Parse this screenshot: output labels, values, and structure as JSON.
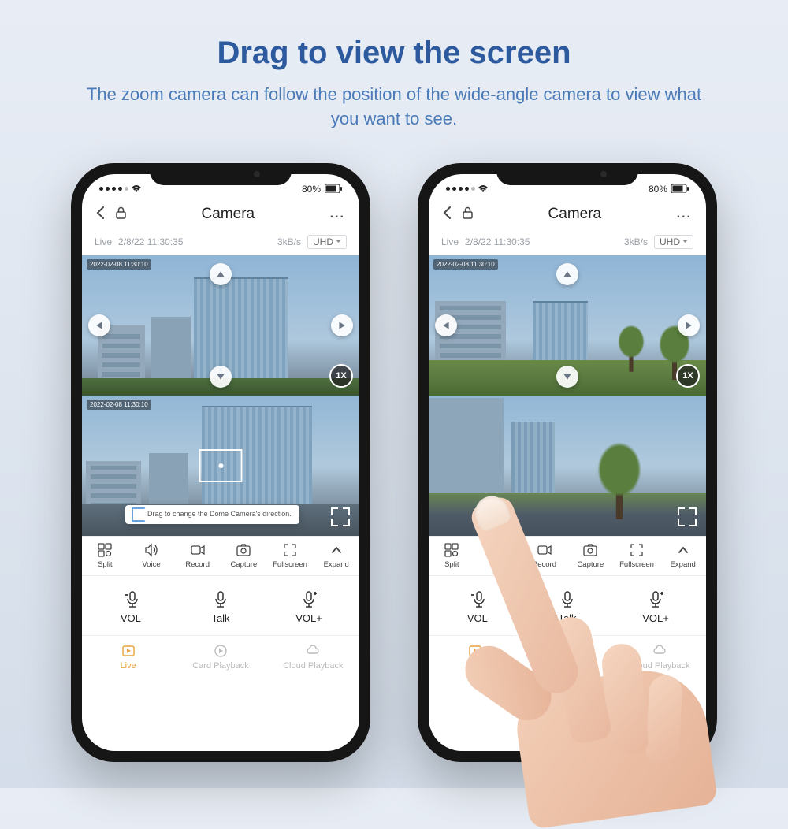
{
  "headline": {
    "title": "Drag to view the screen",
    "subtitle": "The zoom camera can follow the position of the wide-angle camera to view what you want to see."
  },
  "status": {
    "battery": "80%"
  },
  "nav": {
    "title": "Camera",
    "more": "..."
  },
  "info": {
    "live": "Live",
    "datetime": "2/8/22 11:30:35",
    "bitrate": "3kB/s",
    "quality": "UHD"
  },
  "feed": {
    "ts1": "2022-02-08 11:30:10",
    "ts2": "2022-02-08 11:30:10",
    "zoom": "1X",
    "tip": "Drag to change the Dome Camera's direction."
  },
  "tools": {
    "split": "Split",
    "voice": "Voice",
    "record": "Record",
    "capture": "Capture",
    "fullscreen": "Fullscreen",
    "expand": "Expand"
  },
  "vol": {
    "minus": "VOL-",
    "talk": "Talk",
    "plus": "VOL+"
  },
  "tabs": {
    "live": "Live",
    "card": "Card Playback",
    "cloud": "Cloud Playback"
  }
}
